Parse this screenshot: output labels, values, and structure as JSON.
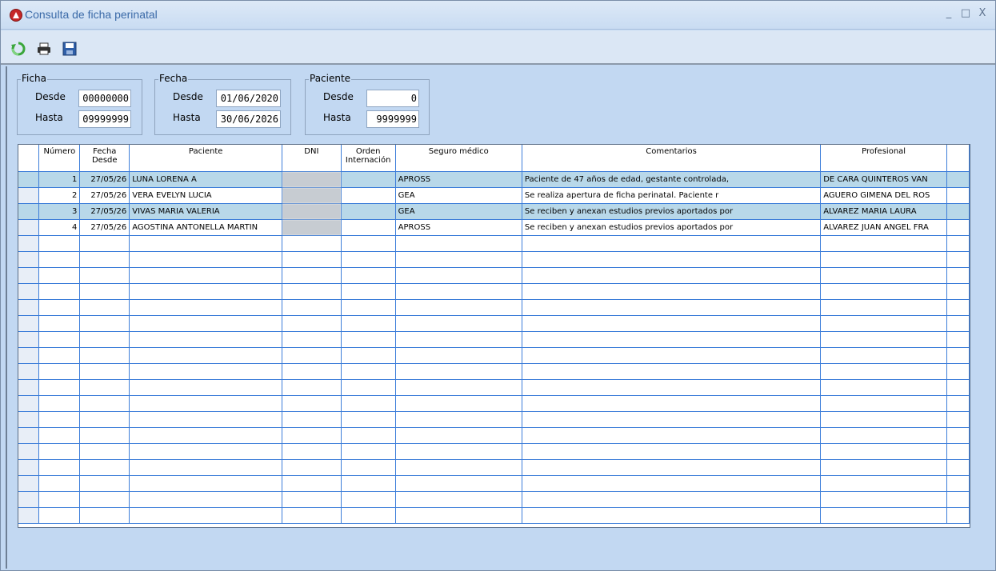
{
  "window": {
    "title": "Consulta de ficha perinatal",
    "controls": {
      "minimize": "_",
      "maximize": "□",
      "close": "X"
    }
  },
  "toolbar": {
    "icons": [
      "refresh-icon",
      "print-icon",
      "save-icon"
    ]
  },
  "filters": {
    "ficha": {
      "label": "Ficha",
      "desde_label": "Desde",
      "desde": "00000000",
      "hasta_label": "Hasta",
      "hasta": "09999999"
    },
    "fecha": {
      "label": "Fecha",
      "desde_label": "Desde",
      "desde": "01/06/2020",
      "hasta_label": "Hasta",
      "hasta": "30/06/2026"
    },
    "paciente": {
      "label": "Paciente",
      "desde_label": "Desde",
      "desde": "0",
      "hasta_label": "Hasta",
      "hasta": "9999999"
    }
  },
  "grid": {
    "columns": [
      "Número",
      "Fecha Desde",
      "Paciente",
      "DNI",
      "Orden Internación",
      "Seguro médico",
      "Comentarios",
      "Profesional"
    ],
    "rows": [
      {
        "numero": "1",
        "fecha": "27/05/26",
        "paciente": "LUNA LORENA A",
        "dni": "",
        "orden": "",
        "seguro": "APROSS",
        "comentarios": "Paciente de 47 años de edad, gestante controlada,",
        "profesional": "DE CARA QUINTEROS VAN"
      },
      {
        "numero": "2",
        "fecha": "27/05/26",
        "paciente": "VERA EVELYN LUCIA",
        "dni": "",
        "orden": "",
        "seguro": "GEA",
        "comentarios": "Se realiza apertura de ficha perinatal. Paciente r",
        "profesional": "AGUERO GIMENA DEL ROS"
      },
      {
        "numero": "3",
        "fecha": "27/05/26",
        "paciente": "VIVAS MARIA VALERIA",
        "dni": "",
        "orden": "",
        "seguro": "GEA",
        "comentarios": "Se reciben y anexan estudios previos aportados por",
        "profesional": "ALVAREZ MARIA LAURA"
      },
      {
        "numero": "4",
        "fecha": "27/05/26",
        "paciente": "AGOSTINA ANTONELLA MARTIN",
        "dni": "",
        "orden": "",
        "seguro": "APROSS",
        "comentarios": "Se reciben y anexan estudios previos aportados por",
        "profesional": "ALVAREZ JUAN ANGEL FRA"
      }
    ]
  }
}
